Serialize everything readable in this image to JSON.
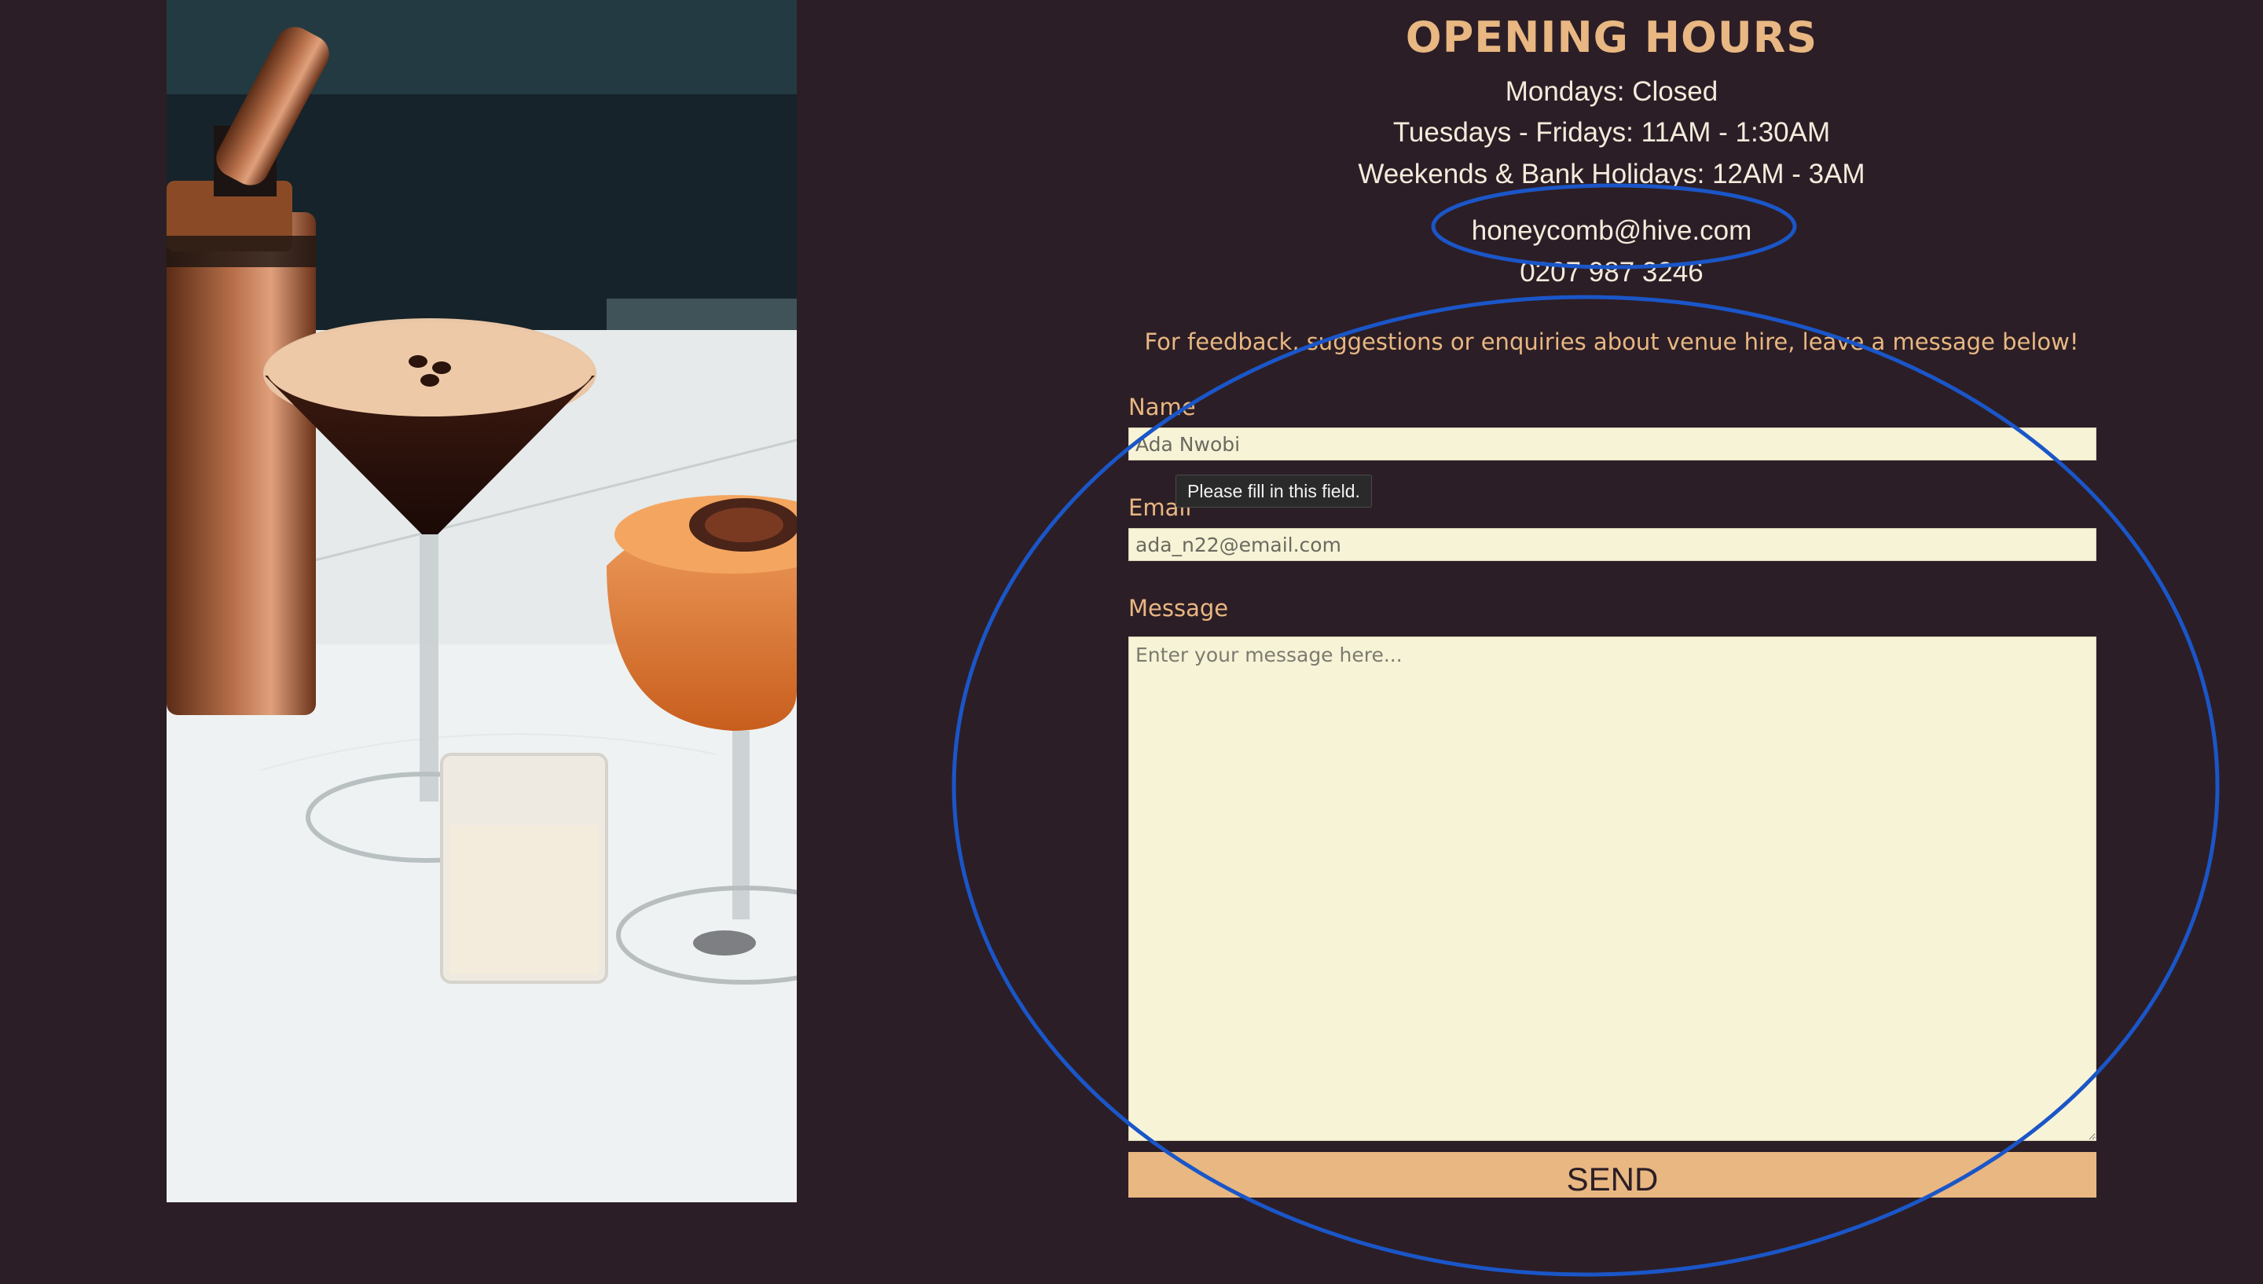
{
  "opening_hours": {
    "title": "OPENING HOURS",
    "lines": [
      "Mondays: Closed",
      "Tuesdays - Fridays: 11AM - 1:30AM",
      "Weekends & Bank Holidays: 12AM - 3AM"
    ]
  },
  "contact": {
    "email": "honeycomb@hive.com",
    "phone": "0207 987 3246"
  },
  "form": {
    "intro": "For feedback, suggestions or enquiries about venue hire, leave a message below!",
    "name": {
      "label": "Name",
      "value": "Ada Nwobi"
    },
    "email": {
      "label": "Email",
      "value": "ada_n22@email.com"
    },
    "message": {
      "label": "Message",
      "placeholder": "Enter your message here...",
      "value": ""
    },
    "send_label": "SEND",
    "validation_tooltip": "Please fill in this field."
  },
  "colors": {
    "background": "#2c1e26",
    "accent": "#e8b782",
    "field_background": "#f7f3d6",
    "text_light": "#f3ecdc",
    "annotation": "#1a56c8"
  },
  "images": {
    "photo": "espresso-martini-cocktails-photo"
  }
}
